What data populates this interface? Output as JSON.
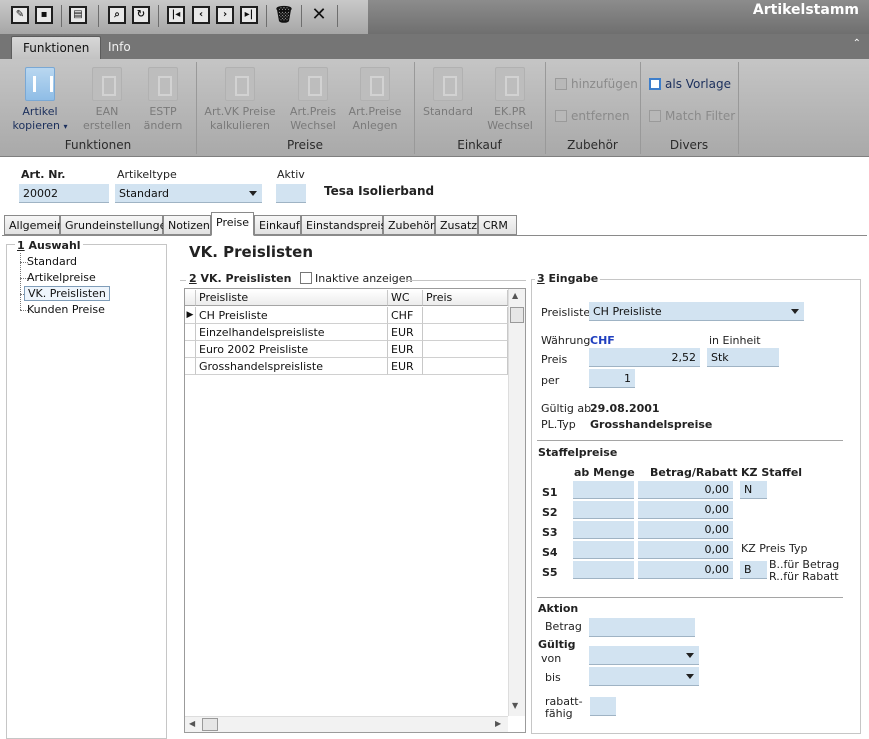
{
  "app": {
    "title": "Artikelstamm"
  },
  "ribbon": {
    "tabs": [
      "Funktionen",
      "Info"
    ],
    "groups": {
      "funktionen": "Funktionen",
      "preise": "Preise",
      "einkauf": "Einkauf",
      "zubehoer": "Zubehör",
      "divers": "Divers"
    },
    "buttons": {
      "artikel_kopieren": [
        "Artikel",
        "kopieren"
      ],
      "ean_erstellen": [
        "EAN",
        "erstellen"
      ],
      "estp_aendern": [
        "ESTP",
        "ändern"
      ],
      "vk_preise": [
        "Art.VK Preise",
        "kalkulieren"
      ],
      "preis_wechsel": [
        "Art.Preis",
        "Wechsel"
      ],
      "preise_anlegen": [
        "Art.Preise",
        "Anlegen"
      ],
      "standard": [
        "Standard",
        ""
      ],
      "ekpr_wechsel": [
        "EK.PR",
        "Wechsel"
      ]
    },
    "small": {
      "hinzufuegen": "hinzufügen",
      "entfernen": "entfernen",
      "als_vorlage": "als Vorlage",
      "match_filter": "Match Filter"
    }
  },
  "header": {
    "art_nr_label": "Art. Nr.",
    "art_nr": "20002",
    "artikeltype_label": "Artikeltype",
    "artikeltype": "Standard",
    "aktiv_label": "Aktiv",
    "aktiv": "",
    "bezeichnung": "Tesa Isolierband"
  },
  "tabs": [
    "Allgemein",
    "Grundeinstellungen",
    "Notizen",
    "Preise",
    "Einkauf",
    "Einstandspreis",
    "Zubehör",
    "Zusatz",
    "CRM"
  ],
  "nav": {
    "num": "1",
    "title": "Auswahl",
    "items": [
      "Standard",
      "Artikelpreise",
      "VK. Preislisten",
      "Kunden Preise"
    ]
  },
  "page_title": "VK. Preislisten",
  "list_section": {
    "num": "2",
    "title": "VK. Preislisten",
    "inactive_label": "Inaktive anzeigen",
    "columns": [
      "Preisliste",
      "WC",
      "Preis"
    ],
    "rows": [
      [
        "CH Preisliste",
        "CHF",
        ""
      ],
      [
        "Einzelhandelspreisliste",
        "EUR",
        ""
      ],
      [
        "Euro 2002 Preisliste",
        "EUR",
        ""
      ],
      [
        "Grosshandelspreisliste",
        "EUR",
        ""
      ]
    ]
  },
  "eingabe": {
    "num": "3",
    "title": "Eingabe",
    "preisliste_label": "Preisliste",
    "preisliste": "CH Preisliste",
    "waehrung_label": "Währung",
    "waehrung": "CHF",
    "einheit_label": "in Einheit",
    "preis_label": "Preis",
    "preis": "2,52",
    "einheit": "Stk",
    "per_label": "per",
    "per": "1",
    "gueltig_ab_label": "Gültig ab",
    "gueltig_ab": "29.08.2001",
    "pltyp_label": "PL.Typ",
    "pltyp": "Grosshandelspreise"
  },
  "staffel": {
    "title": "Staffelpreise",
    "col_menge": "ab Menge",
    "col_betrag": "Betrag/Rabatt",
    "col_kz": "KZ Staffel",
    "rows": [
      {
        "label": "S1",
        "menge": "",
        "betrag": "0,00"
      },
      {
        "label": "S2",
        "menge": "",
        "betrag": "0,00"
      },
      {
        "label": "S3",
        "menge": "",
        "betrag": "0,00"
      },
      {
        "label": "S4",
        "menge": "",
        "betrag": "0,00"
      },
      {
        "label": "S5",
        "menge": "",
        "betrag": "0,00"
      }
    ],
    "kz_staffel": "N",
    "kz_preis_typ_label": "KZ Preis Typ",
    "kz_preis_typ": "B",
    "hint_b": "B..für  Betrag",
    "hint_r": "R..für Rabatt"
  },
  "aktion": {
    "title": "Aktion",
    "betrag_label": "Betrag",
    "gueltig_label": "Gültig",
    "von_label": "von",
    "bis_label": "bis",
    "rabatt_label_1": "rabatt-",
    "rabatt_label_2": "fähig"
  }
}
